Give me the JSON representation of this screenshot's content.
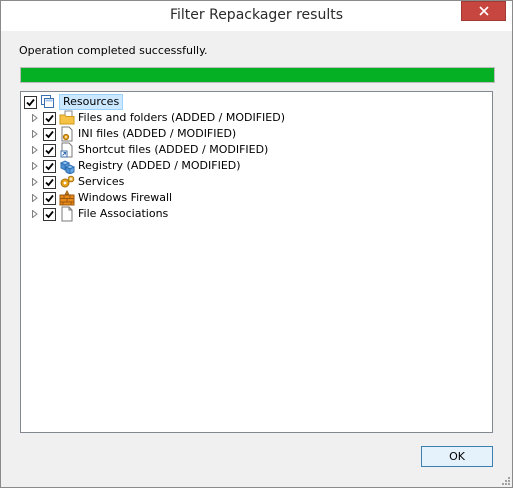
{
  "window": {
    "title": "Filter Repackager results"
  },
  "status_text": "Operation completed successfully.",
  "progress": {
    "percent": 100,
    "color": "#06b025"
  },
  "tree": {
    "root": {
      "label": "Resources",
      "checked": true,
      "icon": "resources-icon",
      "selected": true
    },
    "items": [
      {
        "label": "Files and folders (ADDED / MODIFIED)",
        "checked": true,
        "icon": "folder-icon"
      },
      {
        "label": "INI files (ADDED / MODIFIED)",
        "checked": true,
        "icon": "ini-file-icon"
      },
      {
        "label": "Shortcut files (ADDED / MODIFIED)",
        "checked": true,
        "icon": "shortcut-file-icon"
      },
      {
        "label": "Registry (ADDED / MODIFIED)",
        "checked": true,
        "icon": "registry-icon"
      },
      {
        "label": "Services",
        "checked": true,
        "icon": "services-icon"
      },
      {
        "label": "Windows Firewall",
        "checked": true,
        "icon": "firewall-icon"
      },
      {
        "label": "File Associations",
        "checked": true,
        "icon": "file-association-icon"
      }
    ]
  },
  "buttons": {
    "ok_label": "OK"
  },
  "colors": {
    "close_button": "#c7463f",
    "selection": "#cce8ff",
    "accent_border": "#3c7fb1"
  }
}
